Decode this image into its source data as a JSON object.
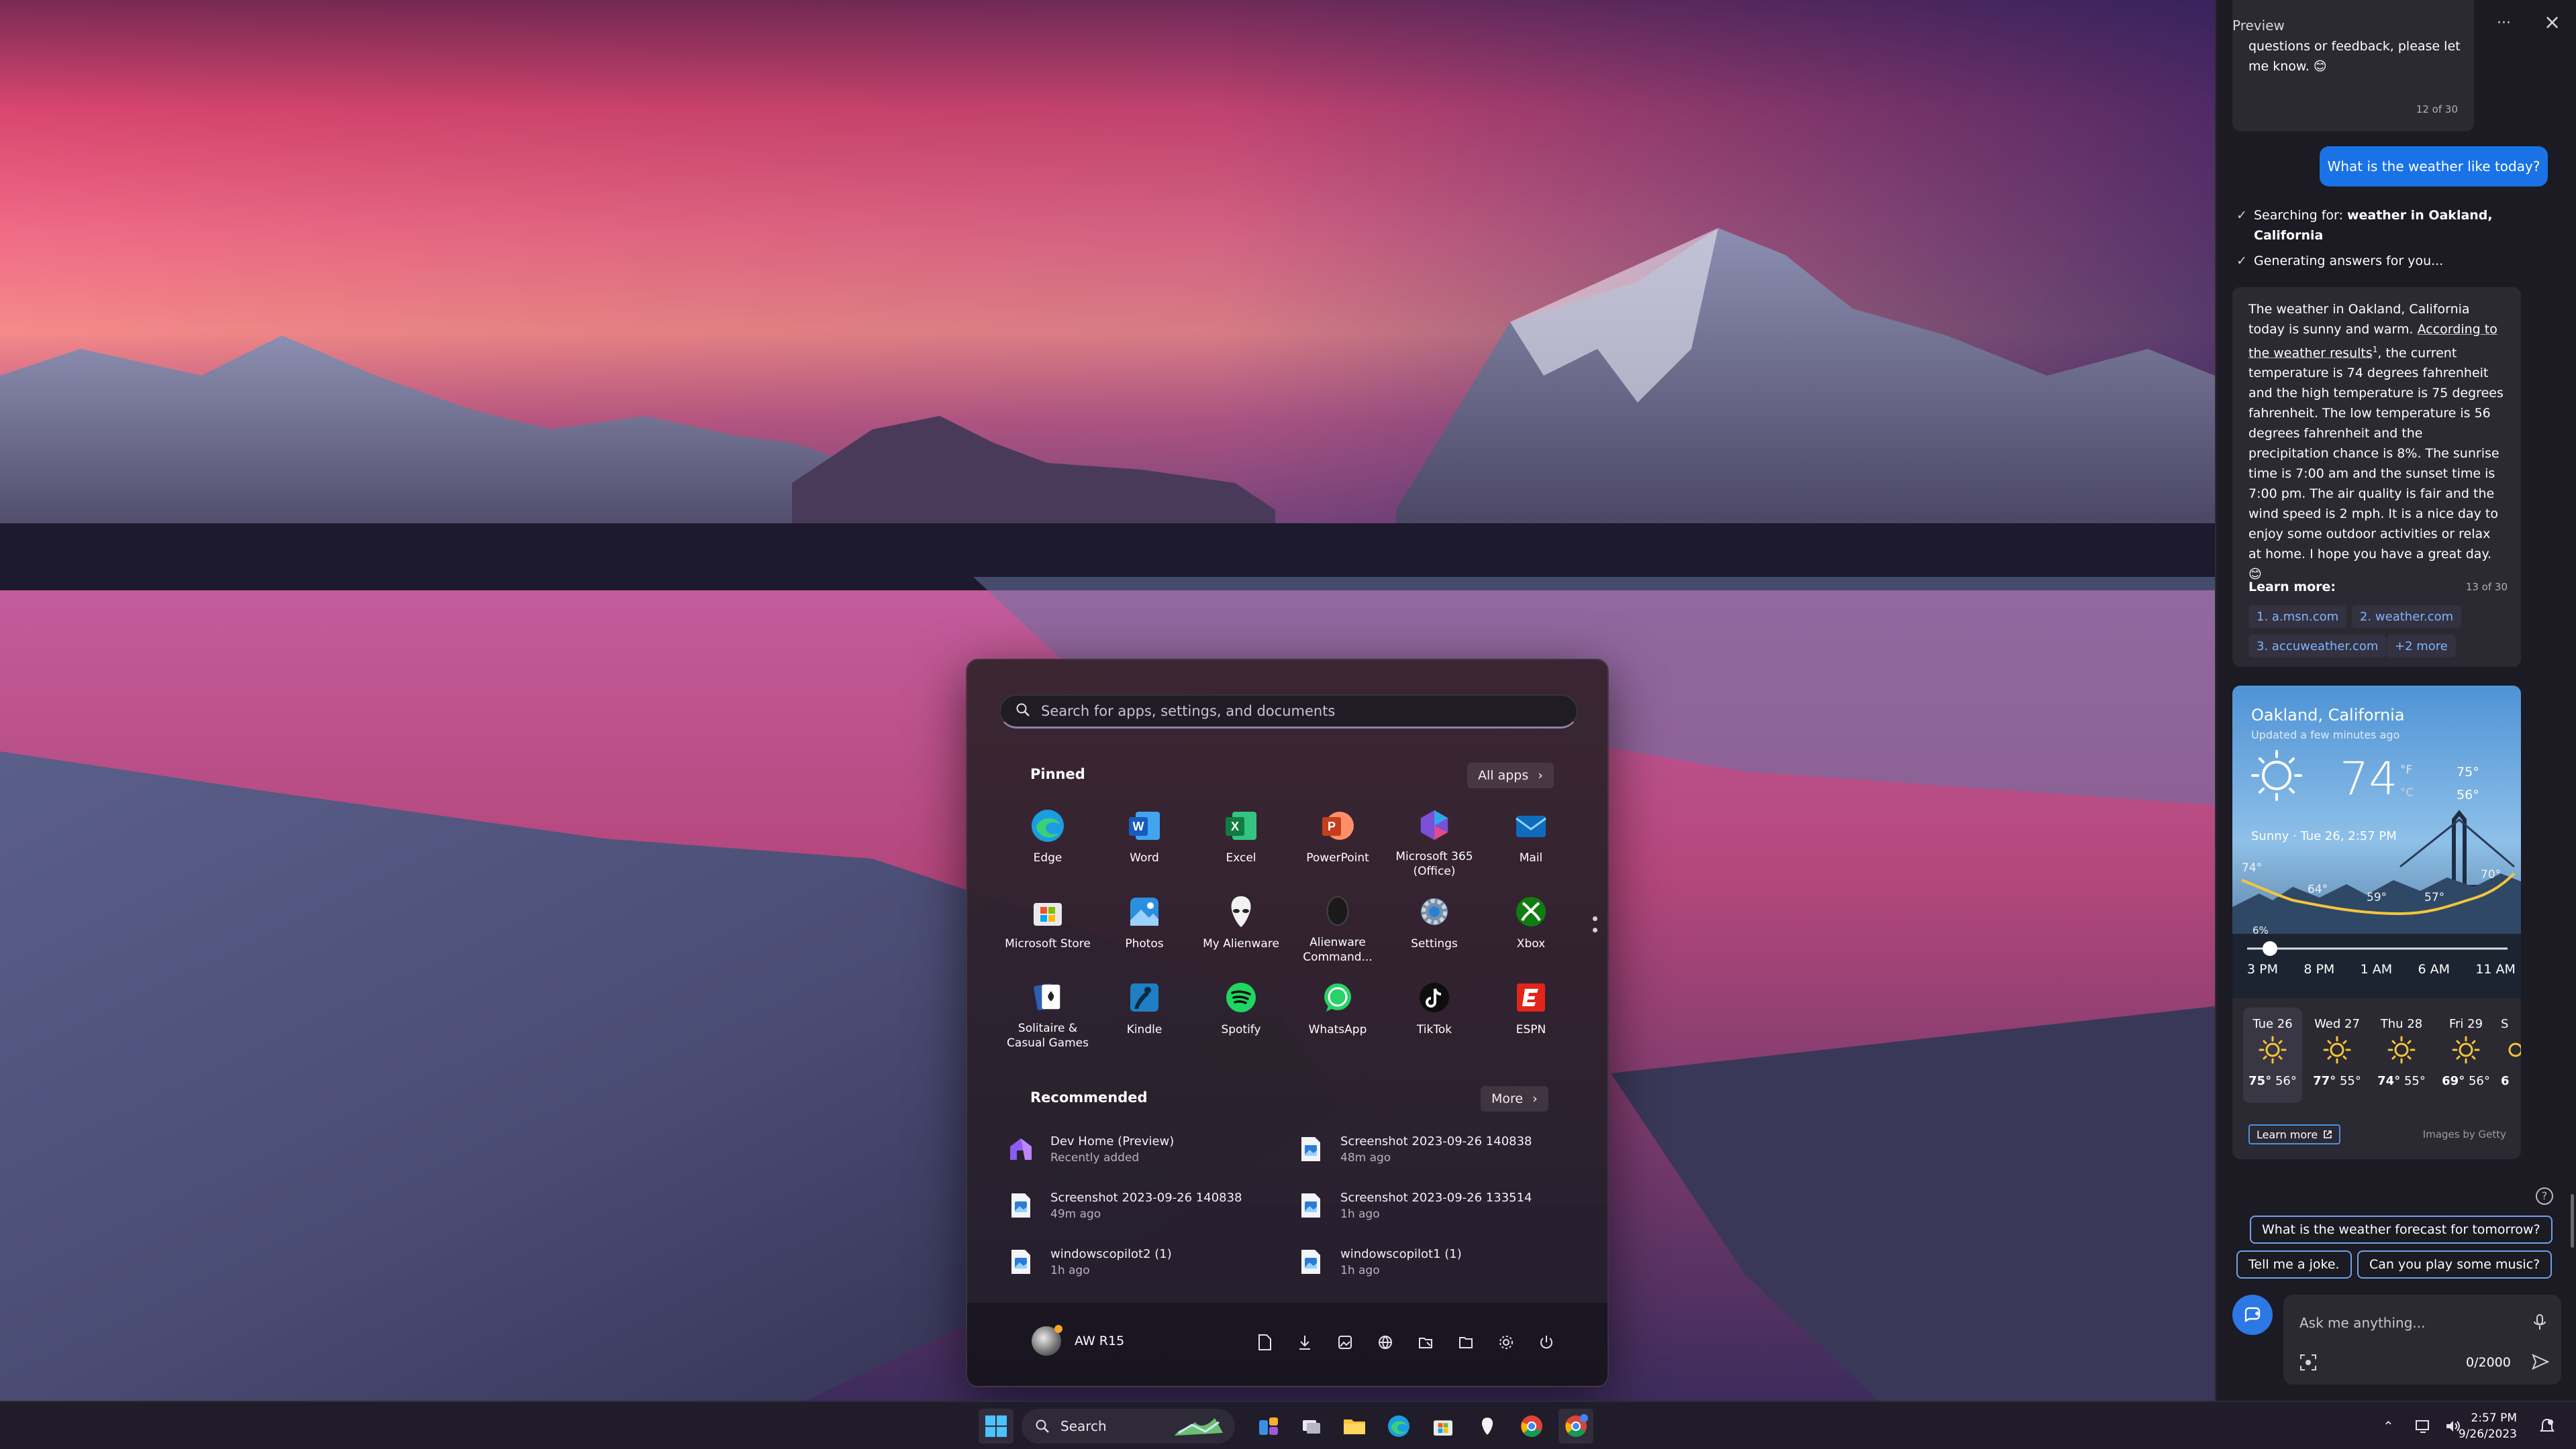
{
  "start_menu": {
    "search_placeholder": "Search for apps, settings, and documents",
    "pinned_title": "Pinned",
    "all_apps": "All apps",
    "pinned": [
      {
        "label": "Edge",
        "icon": "edge-icon"
      },
      {
        "label": "Word",
        "icon": "word-icon"
      },
      {
        "label": "Excel",
        "icon": "excel-icon"
      },
      {
        "label": "PowerPoint",
        "icon": "powerpoint-icon"
      },
      {
        "label": "Microsoft 365 (Office)",
        "icon": "microsoft-365-icon"
      },
      {
        "label": "Mail",
        "icon": "mail-icon"
      },
      {
        "label": "Microsoft Store",
        "icon": "store-icon"
      },
      {
        "label": "Photos",
        "icon": "photos-icon"
      },
      {
        "label": "My Alienware",
        "icon": "alienware-icon"
      },
      {
        "label": "Alienware Command...",
        "icon": "alienware-command-icon"
      },
      {
        "label": "Settings",
        "icon": "settings-icon"
      },
      {
        "label": "Xbox",
        "icon": "xbox-icon"
      },
      {
        "label": "Solitaire & Casual Games",
        "icon": "solitaire-icon"
      },
      {
        "label": "Kindle",
        "icon": "kindle-icon"
      },
      {
        "label": "Spotify",
        "icon": "spotify-icon"
      },
      {
        "label": "WhatsApp",
        "icon": "whatsapp-icon"
      },
      {
        "label": "TikTok",
        "icon": "tiktok-icon"
      },
      {
        "label": "ESPN",
        "icon": "espn-icon"
      }
    ],
    "recommended_title": "Recommended",
    "more": "More",
    "recommended": [
      {
        "title": "Dev Home (Preview)",
        "subtitle": "Recently added",
        "icon": "dev-home-icon"
      },
      {
        "title": "Screenshot 2023-09-26 140838",
        "subtitle": "48m ago",
        "icon": "image-file-icon"
      },
      {
        "title": "Screenshot 2023-09-26 140838",
        "subtitle": "49m ago",
        "icon": "image-file-icon"
      },
      {
        "title": "Screenshot 2023-09-26 133514",
        "subtitle": "1h ago",
        "icon": "image-file-icon"
      },
      {
        "title": "windowscopilot2 (1)",
        "subtitle": "1h ago",
        "icon": "image-file-icon"
      },
      {
        "title": "windowscopilot1 (1)",
        "subtitle": "1h ago",
        "icon": "image-file-icon"
      }
    ],
    "user_name": "AW R15",
    "footer_icons": [
      "documents-icon",
      "downloads-icon",
      "pictures-icon",
      "network-icon",
      "file-explorer-icon",
      "folder-icon",
      "settings-icon",
      "power-icon"
    ]
  },
  "taskbar": {
    "search_label": "Search",
    "time": "2:57 PM",
    "date": "9/26/2023"
  },
  "copilot": {
    "header": "Preview",
    "prev_message_text": "questions or feedback, please let me know. 😊",
    "prev_count": "12 of 30",
    "user_question": "What is the weather like today?",
    "step1_prefix": "Searching for: ",
    "step1_bold": "weather in Oakland, California",
    "step2": "Generating answers for you...",
    "answer_part1": "The weather in Oakland, California today is sunny and warm. ",
    "answer_link": "According to the weather results",
    "answer_sup": "1",
    "answer_part2": ", the current temperature is 74 degrees fahrenheit and the high temperature is 75 degrees fahrenheit. The low temperature is 56 degrees fahrenheit and the precipitation chance is 8%. The sunrise time is 7:00 am and the sunset time is 7:00 pm. The air quality is fair and the wind speed is 2 mph. It is a nice day to enjoy some outdoor activities or relax at home. I hope you have a great day. 😊",
    "learn_more": "Learn more:",
    "answer_count": "13 of 30",
    "sources": [
      "1. a.msn.com",
      "2. weather.com",
      "3. accuweather.com",
      "+2 more"
    ],
    "weather": {
      "city": "Oakland, California",
      "updated": "Updated a few minutes ago",
      "temp": "74",
      "unit_f": "°F",
      "unit_c": "°C",
      "high": "75°",
      "low": "56°",
      "condition": "Sunny · Tue 26, 2:57 PM",
      "graph_labels": [
        "74°",
        "64°",
        "59°",
        "57°",
        "70°"
      ],
      "precip": "6%",
      "hours": [
        "3 PM",
        "8 PM",
        "1 AM",
        "6 AM",
        "11 AM"
      ],
      "days": [
        {
          "name": "Tue 26",
          "high": "75°",
          "low": "56°"
        },
        {
          "name": "Wed 27",
          "high": "77°",
          "low": "55°"
        },
        {
          "name": "Thu 28",
          "high": "74°",
          "low": "55°"
        },
        {
          "name": "Fri 29",
          "high": "69°",
          "low": "56°"
        },
        {
          "name": "S",
          "high": "6",
          "low": ""
        }
      ],
      "learn_more": "Learn more",
      "images_by": "Images by Getty"
    },
    "suggestions": [
      "What is the weather forecast for tomorrow?",
      "Tell me a joke.",
      "Can you play some music?"
    ],
    "input_placeholder": "Ask me anything...",
    "char_count": "0/2000"
  }
}
